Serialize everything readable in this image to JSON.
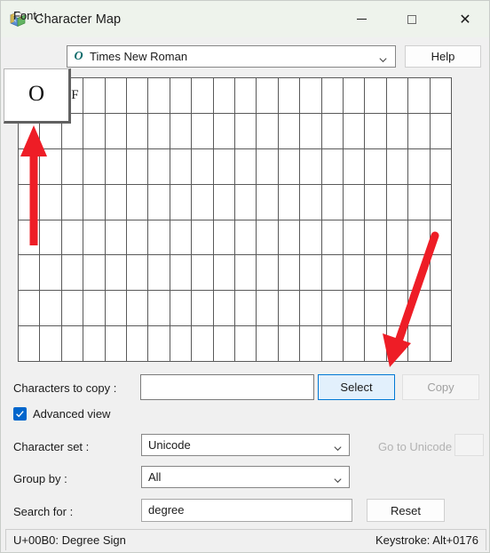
{
  "window": {
    "title": "Character Map",
    "icon": "character-map-icon",
    "controls": {
      "minimize": "minimize-icon",
      "maximize": "maximize-icon",
      "close": "close-icon"
    },
    "titlebar_color": "#eef3ec",
    "background_color": "#f0f0f0"
  },
  "font_row": {
    "label": "Font :",
    "font_icon": "O",
    "font_value": "Times New Roman",
    "dropdown_icon": "chevron-down-icon",
    "help_label": "Help"
  },
  "magnifier": {
    "char": "°",
    "display_char": "O"
  },
  "grid": {
    "columns": 20,
    "rows": 8,
    "cells": [
      "",
      "",
      "°F",
      "",
      "",
      "",
      "",
      "",
      "",
      "",
      "",
      "",
      "",
      "",
      "",
      "",
      "",
      "",
      "",
      "",
      "",
      "",
      "",
      "",
      "",
      "",
      "",
      "",
      "",
      "",
      "",
      "",
      "",
      "",
      "",
      "",
      "",
      "",
      "",
      "",
      "",
      "",
      "",
      "",
      "",
      "",
      "",
      "",
      "",
      "",
      "",
      "",
      "",
      "",
      "",
      "",
      "",
      "",
      "",
      "",
      "",
      "",
      "",
      "",
      "",
      "",
      "",
      "",
      "",
      "",
      "",
      "",
      "",
      "",
      "",
      "",
      "",
      "",
      "",
      "",
      "",
      "",
      "",
      "",
      "",
      "",
      "",
      "",
      "",
      "",
      "",
      "",
      "",
      "",
      "",
      "",
      "",
      "",
      "",
      "",
      "",
      "",
      "",
      "",
      "",
      "",
      "",
      "",
      "",
      "",
      "",
      "",
      "",
      "",
      "",
      "",
      "",
      "",
      "",
      "",
      "",
      "",
      "",
      "",
      "",
      "",
      "",
      "",
      "",
      "",
      "",
      "",
      "",
      "",
      "",
      "",
      "",
      "",
      "",
      "",
      "",
      "",
      "",
      "",
      "",
      "",
      "",
      "",
      "",
      "",
      "",
      "",
      "",
      "",
      "",
      "",
      "",
      "",
      "",
      ""
    ]
  },
  "copy_row": {
    "label": "Characters to copy :",
    "input_value": "",
    "select_label": "Select",
    "copy_label": "Copy",
    "copy_disabled": true,
    "select_focus_color": "#0078d4"
  },
  "advanced": {
    "label": "Advanced view",
    "checked": true,
    "check_color": "#0066cc",
    "check_icon": "checkmark-icon"
  },
  "charset_row": {
    "label": "Character set :",
    "value": "Unicode",
    "dropdown_icon": "chevron-down-icon",
    "goto_label": "Go to Unicode :",
    "goto_value": "",
    "goto_disabled": true
  },
  "groupby_row": {
    "label": "Group by :",
    "value": "All",
    "dropdown_icon": "chevron-down-icon"
  },
  "search_row": {
    "label": "Search for :",
    "value": "degree",
    "reset_label": "Reset"
  },
  "statusbar": {
    "left": "U+00B0: Degree Sign",
    "right": "Keystroke: Alt+0176"
  },
  "annotations": {
    "arrow_color": "#ee1d26",
    "arrow_up_name": "annotation-arrow-up",
    "arrow_down_name": "annotation-arrow-down"
  }
}
